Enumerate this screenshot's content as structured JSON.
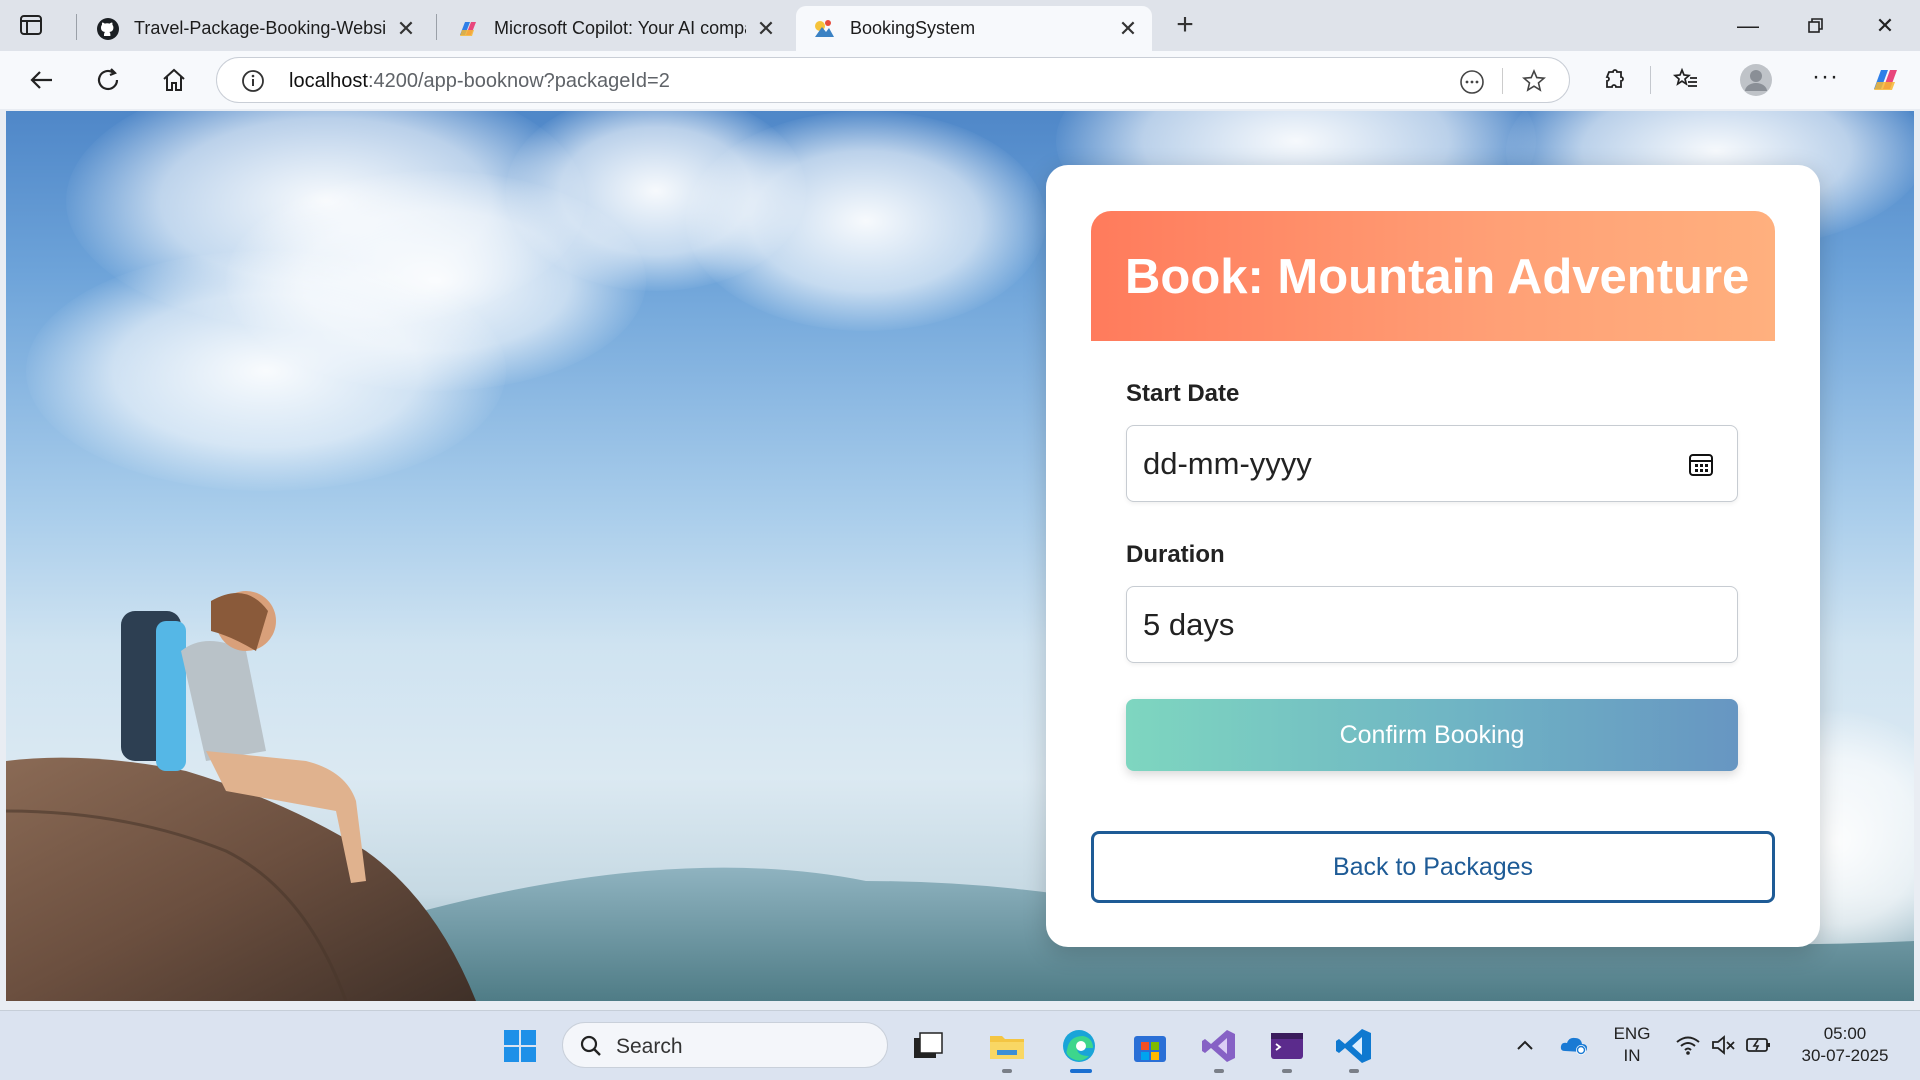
{
  "browser": {
    "tabs": [
      {
        "title": "Travel-Package-Booking-Website",
        "favicon": "github-icon",
        "active": false
      },
      {
        "title": "Microsoft Copilot: Your AI companion",
        "favicon": "copilot-icon",
        "active": false
      },
      {
        "title": "BookingSystem",
        "favicon": "angular-app-icon",
        "active": true
      }
    ],
    "address": {
      "host": "localhost",
      "path": ":4200/app-booknow?packageId=2"
    }
  },
  "booking": {
    "heading": "Book: Mountain Adventure",
    "start_date_label": "Start Date",
    "start_date_placeholder": "dd-mm-yyyy",
    "duration_label": "Duration",
    "duration_value": "5 days",
    "confirm_label": "Confirm Booking",
    "back_label": "Back to Packages"
  },
  "taskbar": {
    "search_placeholder": "Search",
    "language_line1": "ENG",
    "language_line2": "IN",
    "time": "05:00",
    "date": "30-07-2025"
  },
  "colors": {
    "header_gradient_start": "#ff7b5c",
    "header_gradient_end": "#ffb07e",
    "confirm_gradient_start": "#7ed6c0",
    "confirm_gradient_end": "#6796c2",
    "back_border": "#1e5b96"
  }
}
